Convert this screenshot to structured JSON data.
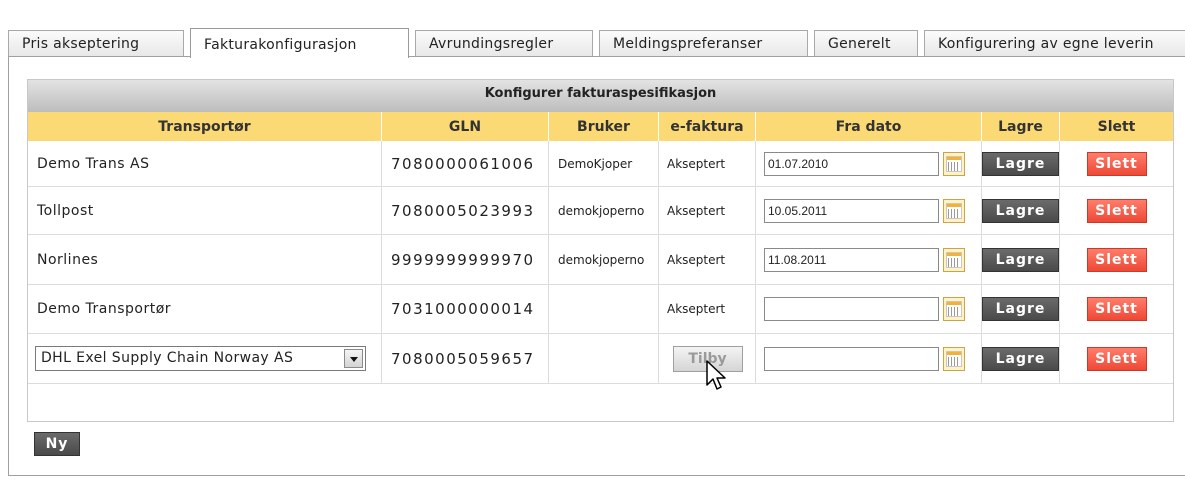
{
  "tabs": [
    {
      "label": "Pris akseptering"
    },
    {
      "label": "Fakturakonfigurasjon"
    },
    {
      "label": "Avrundingsregler"
    },
    {
      "label": "Meldingspreferanser"
    },
    {
      "label": "Generelt"
    },
    {
      "label": "Konfigurering av egne leverin"
    }
  ],
  "active_tab": "Fakturakonfigurasjon",
  "grid": {
    "caption": "Konfigurer fakturaspesifikasjon",
    "headers": {
      "transport": "Transportør",
      "gln": "GLN",
      "user": "Bruker",
      "efaktura": "e-faktura",
      "date": "Fra dato",
      "save": "Lagre",
      "delete": "Slett"
    },
    "rows": [
      {
        "transport": "Demo Trans AS",
        "gln": "7080000061006",
        "user": "DemoKjoper",
        "efaktura": "Akseptert",
        "date": "01.07.2010",
        "save": "Lagre",
        "delete": "Slett"
      },
      {
        "transport": "Tollpost",
        "gln": "7080005023993",
        "user": "demokjoperno",
        "efaktura": "Akseptert",
        "date": "10.05.2011",
        "save": "Lagre",
        "delete": "Slett"
      },
      {
        "transport": "Norlines",
        "gln": "9999999999970",
        "user": "demokjoperno",
        "efaktura": "Akseptert",
        "date": "11.08.2011",
        "save": "Lagre",
        "delete": "Slett"
      },
      {
        "transport": "Demo Transportør",
        "gln": "7031000000014",
        "user": "",
        "efaktura": "Akseptert",
        "date": "",
        "save": "Lagre",
        "delete": "Slett"
      },
      {
        "transport": "DHL Exel Supply Chain Norway AS",
        "gln": "7080005059657",
        "user": "",
        "efaktura": "Tilby",
        "date": "",
        "save": "Lagre",
        "delete": "Slett"
      }
    ]
  },
  "new_button": "Ny",
  "icons": {
    "calendar": "calendar-icon",
    "dropdown": "chevron-down-icon",
    "cursor": "mouse-pointer-icon"
  },
  "colors": {
    "header_bg": "#fbd974",
    "save_button": "#4f4f4f",
    "delete_button": "#f35a47",
    "tab_border": "#a9a9a9"
  }
}
